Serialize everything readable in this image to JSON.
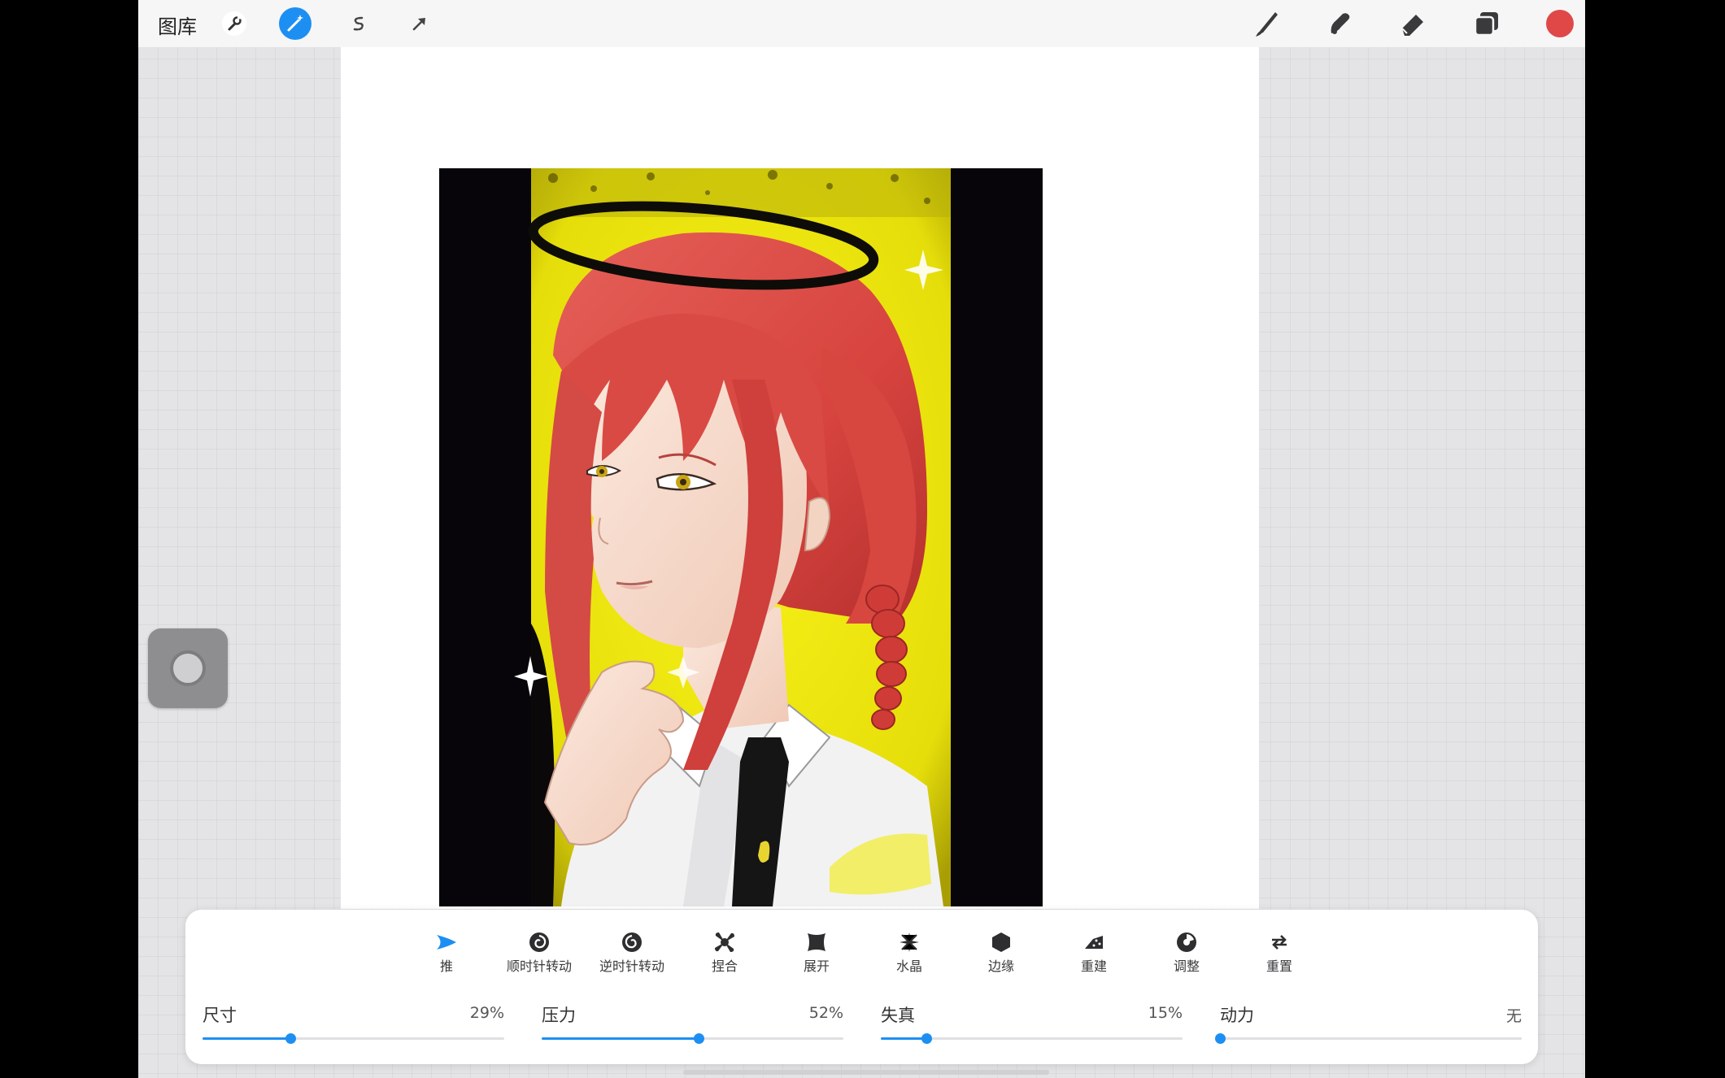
{
  "topbar": {
    "gallery_label": "图库",
    "left_tools": [
      "wrench-icon",
      "magic-wand-icon",
      "selection-icon",
      "transform-arrow-icon"
    ],
    "right_tools": [
      "brush-icon",
      "smudge-icon",
      "eraser-icon",
      "layers-icon",
      "color-swatch"
    ],
    "active_color": "#e04848",
    "accent": "#1d8ff2"
  },
  "liquify": {
    "modes": [
      {
        "label": "推",
        "icon": "push-icon",
        "active": true
      },
      {
        "label": "顺时针转动",
        "icon": "twirl-right-icon"
      },
      {
        "label": "逆时针转动",
        "icon": "twirl-left-icon"
      },
      {
        "label": "捏合",
        "icon": "pinch-icon"
      },
      {
        "label": "展开",
        "icon": "expand-icon"
      },
      {
        "label": "水晶",
        "icon": "crystals-icon"
      },
      {
        "label": "边缘",
        "icon": "edge-icon"
      },
      {
        "label": "重建",
        "icon": "reconstruct-icon"
      },
      {
        "label": "调整",
        "icon": "adjust-icon"
      },
      {
        "label": "重置",
        "icon": "reset-icon"
      }
    ],
    "sliders": [
      {
        "label": "尺寸",
        "value_text": "29%",
        "value": 0.29
      },
      {
        "label": "压力",
        "value_text": "52%",
        "value": 0.52
      },
      {
        "label": "失真",
        "value_text": "15%",
        "value": 0.15
      },
      {
        "label": "动力",
        "value_text": "无",
        "value": 0.0
      }
    ]
  }
}
